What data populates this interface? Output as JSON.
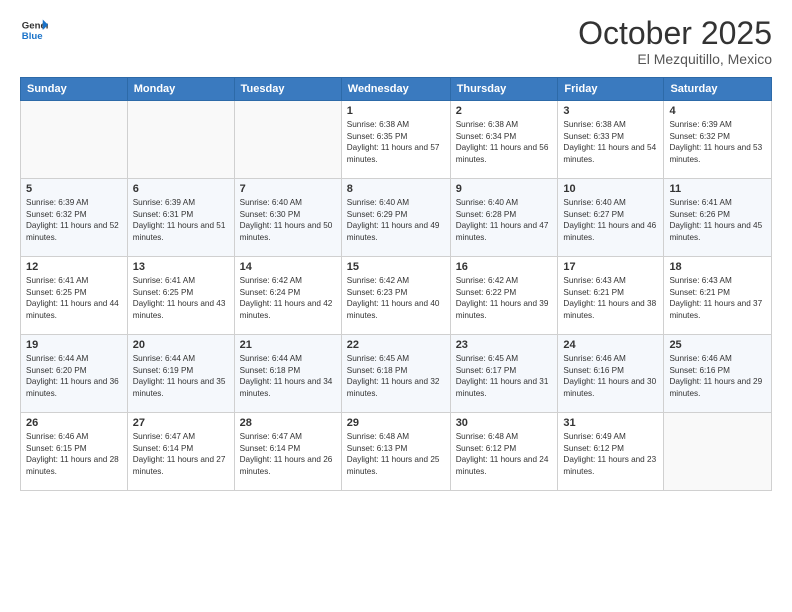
{
  "logo": {
    "line1": "General",
    "line2": "Blue"
  },
  "title": "October 2025",
  "location": "El Mezquitillo, Mexico",
  "days_of_week": [
    "Sunday",
    "Monday",
    "Tuesday",
    "Wednesday",
    "Thursday",
    "Friday",
    "Saturday"
  ],
  "weeks": [
    [
      {
        "day": "",
        "sunrise": "",
        "sunset": "",
        "daylight": ""
      },
      {
        "day": "",
        "sunrise": "",
        "sunset": "",
        "daylight": ""
      },
      {
        "day": "",
        "sunrise": "",
        "sunset": "",
        "daylight": ""
      },
      {
        "day": "1",
        "sunrise": "Sunrise: 6:38 AM",
        "sunset": "Sunset: 6:35 PM",
        "daylight": "Daylight: 11 hours and 57 minutes."
      },
      {
        "day": "2",
        "sunrise": "Sunrise: 6:38 AM",
        "sunset": "Sunset: 6:34 PM",
        "daylight": "Daylight: 11 hours and 56 minutes."
      },
      {
        "day": "3",
        "sunrise": "Sunrise: 6:38 AM",
        "sunset": "Sunset: 6:33 PM",
        "daylight": "Daylight: 11 hours and 54 minutes."
      },
      {
        "day": "4",
        "sunrise": "Sunrise: 6:39 AM",
        "sunset": "Sunset: 6:32 PM",
        "daylight": "Daylight: 11 hours and 53 minutes."
      }
    ],
    [
      {
        "day": "5",
        "sunrise": "Sunrise: 6:39 AM",
        "sunset": "Sunset: 6:32 PM",
        "daylight": "Daylight: 11 hours and 52 minutes."
      },
      {
        "day": "6",
        "sunrise": "Sunrise: 6:39 AM",
        "sunset": "Sunset: 6:31 PM",
        "daylight": "Daylight: 11 hours and 51 minutes."
      },
      {
        "day": "7",
        "sunrise": "Sunrise: 6:40 AM",
        "sunset": "Sunset: 6:30 PM",
        "daylight": "Daylight: 11 hours and 50 minutes."
      },
      {
        "day": "8",
        "sunrise": "Sunrise: 6:40 AM",
        "sunset": "Sunset: 6:29 PM",
        "daylight": "Daylight: 11 hours and 49 minutes."
      },
      {
        "day": "9",
        "sunrise": "Sunrise: 6:40 AM",
        "sunset": "Sunset: 6:28 PM",
        "daylight": "Daylight: 11 hours and 47 minutes."
      },
      {
        "day": "10",
        "sunrise": "Sunrise: 6:40 AM",
        "sunset": "Sunset: 6:27 PM",
        "daylight": "Daylight: 11 hours and 46 minutes."
      },
      {
        "day": "11",
        "sunrise": "Sunrise: 6:41 AM",
        "sunset": "Sunset: 6:26 PM",
        "daylight": "Daylight: 11 hours and 45 minutes."
      }
    ],
    [
      {
        "day": "12",
        "sunrise": "Sunrise: 6:41 AM",
        "sunset": "Sunset: 6:25 PM",
        "daylight": "Daylight: 11 hours and 44 minutes."
      },
      {
        "day": "13",
        "sunrise": "Sunrise: 6:41 AM",
        "sunset": "Sunset: 6:25 PM",
        "daylight": "Daylight: 11 hours and 43 minutes."
      },
      {
        "day": "14",
        "sunrise": "Sunrise: 6:42 AM",
        "sunset": "Sunset: 6:24 PM",
        "daylight": "Daylight: 11 hours and 42 minutes."
      },
      {
        "day": "15",
        "sunrise": "Sunrise: 6:42 AM",
        "sunset": "Sunset: 6:23 PM",
        "daylight": "Daylight: 11 hours and 40 minutes."
      },
      {
        "day": "16",
        "sunrise": "Sunrise: 6:42 AM",
        "sunset": "Sunset: 6:22 PM",
        "daylight": "Daylight: 11 hours and 39 minutes."
      },
      {
        "day": "17",
        "sunrise": "Sunrise: 6:43 AM",
        "sunset": "Sunset: 6:21 PM",
        "daylight": "Daylight: 11 hours and 38 minutes."
      },
      {
        "day": "18",
        "sunrise": "Sunrise: 6:43 AM",
        "sunset": "Sunset: 6:21 PM",
        "daylight": "Daylight: 11 hours and 37 minutes."
      }
    ],
    [
      {
        "day": "19",
        "sunrise": "Sunrise: 6:44 AM",
        "sunset": "Sunset: 6:20 PM",
        "daylight": "Daylight: 11 hours and 36 minutes."
      },
      {
        "day": "20",
        "sunrise": "Sunrise: 6:44 AM",
        "sunset": "Sunset: 6:19 PM",
        "daylight": "Daylight: 11 hours and 35 minutes."
      },
      {
        "day": "21",
        "sunrise": "Sunrise: 6:44 AM",
        "sunset": "Sunset: 6:18 PM",
        "daylight": "Daylight: 11 hours and 34 minutes."
      },
      {
        "day": "22",
        "sunrise": "Sunrise: 6:45 AM",
        "sunset": "Sunset: 6:18 PM",
        "daylight": "Daylight: 11 hours and 32 minutes."
      },
      {
        "day": "23",
        "sunrise": "Sunrise: 6:45 AM",
        "sunset": "Sunset: 6:17 PM",
        "daylight": "Daylight: 11 hours and 31 minutes."
      },
      {
        "day": "24",
        "sunrise": "Sunrise: 6:46 AM",
        "sunset": "Sunset: 6:16 PM",
        "daylight": "Daylight: 11 hours and 30 minutes."
      },
      {
        "day": "25",
        "sunrise": "Sunrise: 6:46 AM",
        "sunset": "Sunset: 6:16 PM",
        "daylight": "Daylight: 11 hours and 29 minutes."
      }
    ],
    [
      {
        "day": "26",
        "sunrise": "Sunrise: 6:46 AM",
        "sunset": "Sunset: 6:15 PM",
        "daylight": "Daylight: 11 hours and 28 minutes."
      },
      {
        "day": "27",
        "sunrise": "Sunrise: 6:47 AM",
        "sunset": "Sunset: 6:14 PM",
        "daylight": "Daylight: 11 hours and 27 minutes."
      },
      {
        "day": "28",
        "sunrise": "Sunrise: 6:47 AM",
        "sunset": "Sunset: 6:14 PM",
        "daylight": "Daylight: 11 hours and 26 minutes."
      },
      {
        "day": "29",
        "sunrise": "Sunrise: 6:48 AM",
        "sunset": "Sunset: 6:13 PM",
        "daylight": "Daylight: 11 hours and 25 minutes."
      },
      {
        "day": "30",
        "sunrise": "Sunrise: 6:48 AM",
        "sunset": "Sunset: 6:12 PM",
        "daylight": "Daylight: 11 hours and 24 minutes."
      },
      {
        "day": "31",
        "sunrise": "Sunrise: 6:49 AM",
        "sunset": "Sunset: 6:12 PM",
        "daylight": "Daylight: 11 hours and 23 minutes."
      },
      {
        "day": "",
        "sunrise": "",
        "sunset": "",
        "daylight": ""
      }
    ]
  ]
}
